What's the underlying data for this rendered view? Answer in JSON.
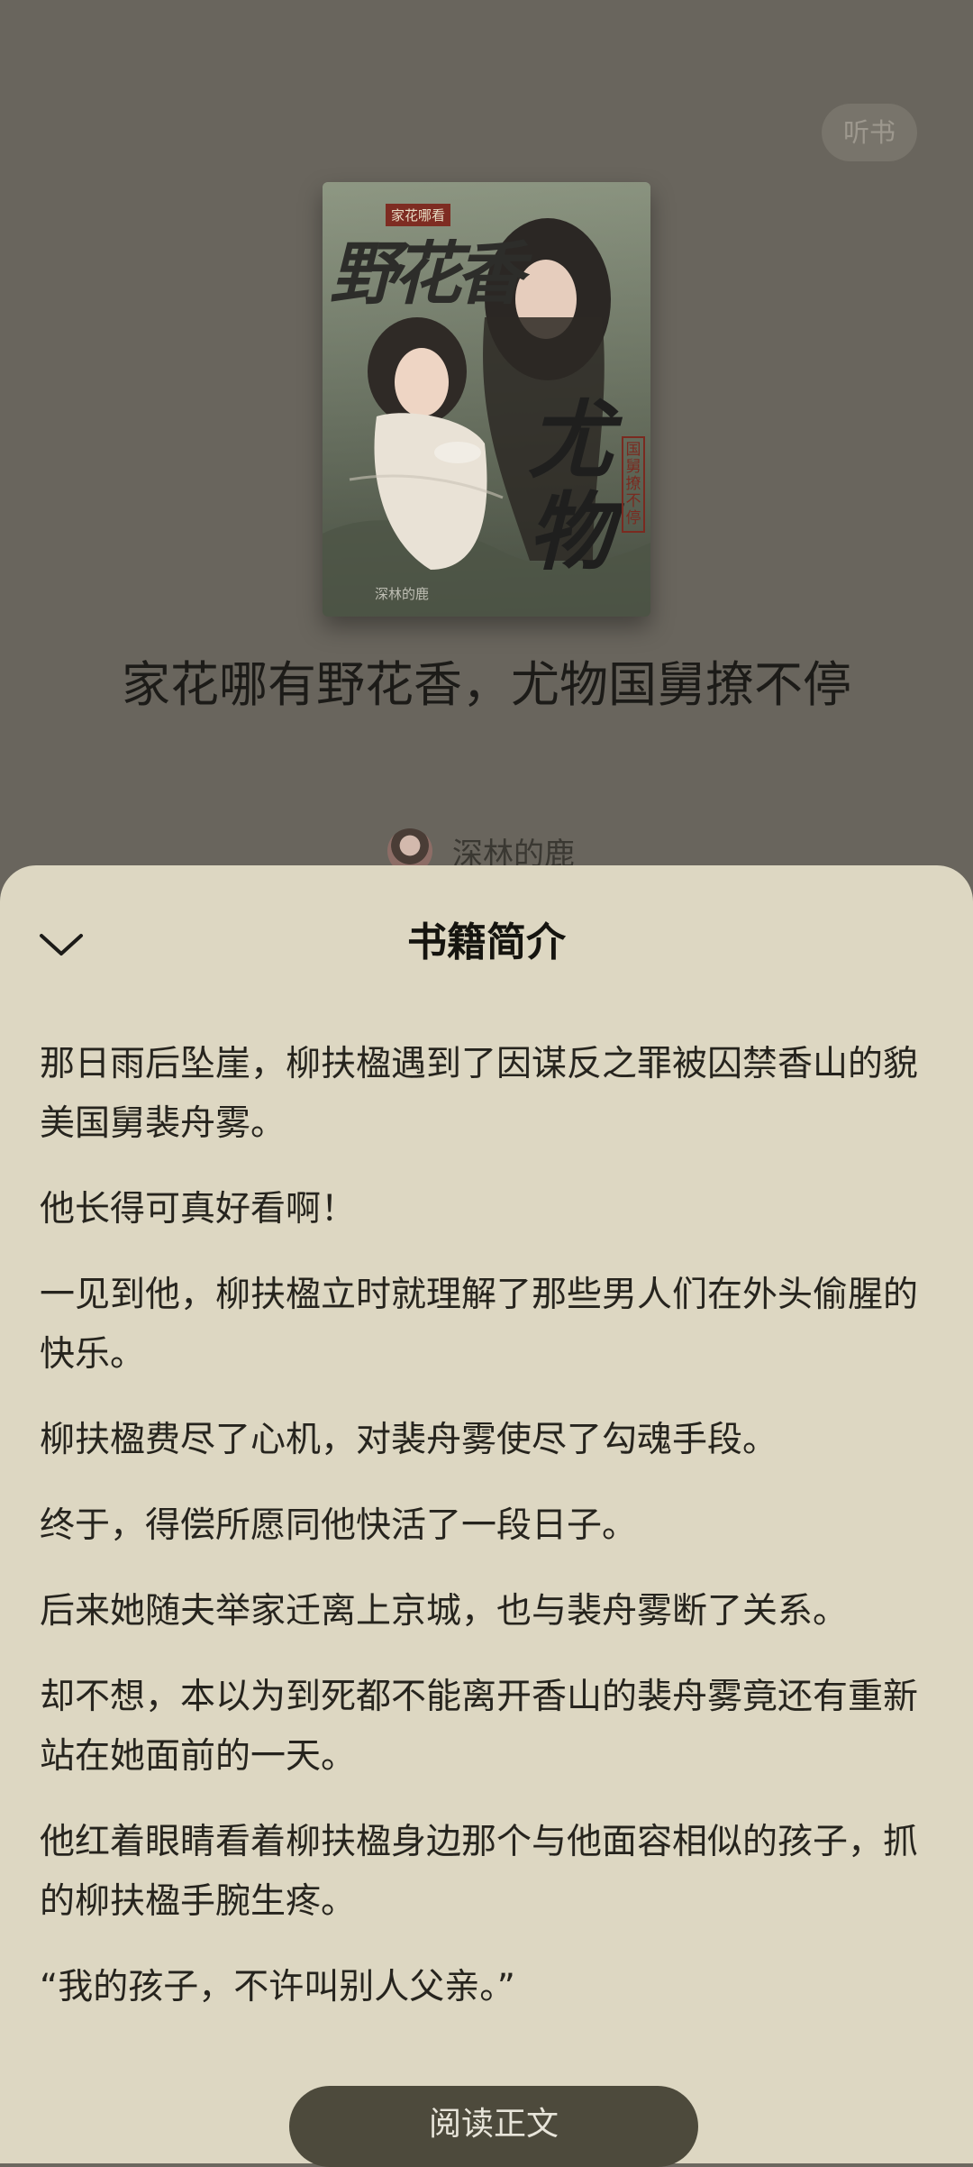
{
  "header": {
    "listen_label": "听书"
  },
  "cover": {
    "tag_text": "家花哪看",
    "title_part1": "野花香",
    "title_part2": "尤物",
    "seal_text": "国舅撩不停",
    "author_small": "深林的鹿",
    "image_description_icon": "book-cover-illustration"
  },
  "book": {
    "title": "家花哪有野花香，尤物国舅撩不停",
    "author": "深林的鹿"
  },
  "sheet": {
    "title": "书籍简介",
    "collapse_icon": "chevron-down-icon",
    "paragraphs": [
      "那日雨后坠崖，柳扶楹遇到了因谋反之罪被囚禁香山的貌美国舅裴舟雾。",
      "他长得可真好看啊！",
      "一见到他，柳扶楹立时就理解了那些男人们在外头偷腥的快乐。",
      "柳扶楹费尽了心机，对裴舟雾使尽了勾魂手段。",
      "终于，得偿所愿同他快活了一段日子。",
      "后来她随夫举家迁离上京城，也与裴舟雾断了关系。",
      "却不想，本以为到死都不能离开香山的裴舟雾竟还有重新站在她面前的一天。",
      "他红着眼睛看着柳扶楹身边那个与他面容相似的孩子，抓的柳扶楹手腕生疼。",
      "“我的孩子，不许叫别人父亲。”"
    ],
    "read_button_label": "阅读正文"
  },
  "colors": {
    "overlay_background": "#69655d",
    "sheet_background": "#ddd7c2",
    "button_background": "#4d4a3c",
    "button_text": "#e8e5da"
  }
}
